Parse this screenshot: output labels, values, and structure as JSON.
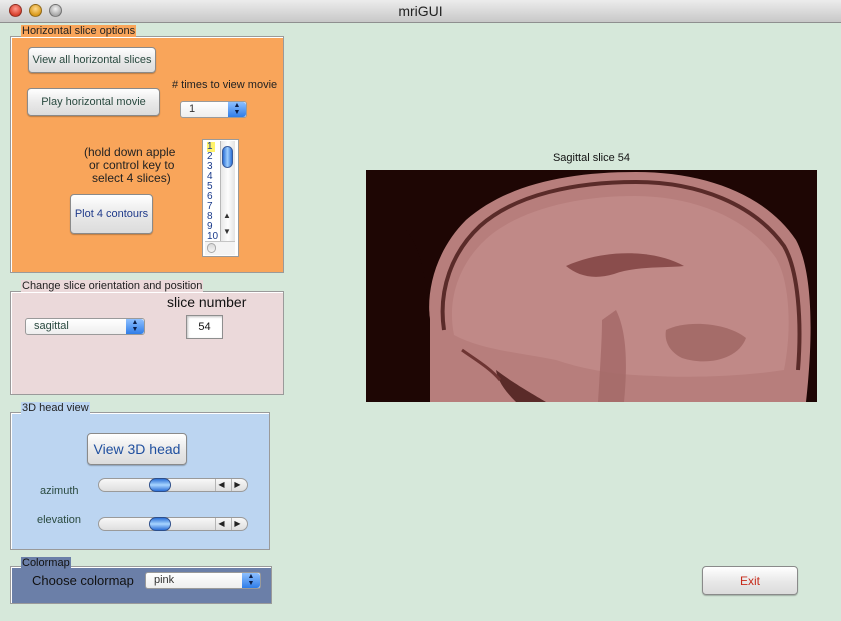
{
  "window": {
    "title": "mriGUI"
  },
  "horizontal": {
    "title": "Horizontal slice options",
    "view_all_label": "View all horizontal slices",
    "play_movie_label": "Play horizontal movie",
    "times_label": "# times to view movie",
    "times_value": "1",
    "hint_lines": [
      "(hold down apple",
      "or control key to",
      "select 4 slices)"
    ],
    "plot_contours_label": "Plot 4 contours",
    "slice_list": [
      "1",
      "2",
      "3",
      "4",
      "5",
      "6",
      "7",
      "8",
      "9",
      "10"
    ],
    "selected_slice": "1"
  },
  "orientation": {
    "title": "Change slice orientation and position",
    "slice_number_label": "slice number",
    "orientation_value": "sagittal",
    "slice_number_value": "54"
  },
  "head3d": {
    "title": "3D head view",
    "view_button_label": "View 3D head",
    "azimuth_label": "azimuth",
    "elevation_label": "elevation"
  },
  "colormap": {
    "title": "Colormap",
    "choose_label": "Choose colormap",
    "value": "pink"
  },
  "image": {
    "caption": "Sagittal slice 54"
  },
  "exit_label": "Exit",
  "colors": {
    "window_bg": "#d6e8da",
    "horizontal_bg": "#f9a55a",
    "orientation_bg": "#ebd9da",
    "head3d_bg": "#bcd5f1",
    "colormap_bg": "#6b7fa8",
    "mri_tissue": "#b77e7c",
    "mri_background": "#1e0604"
  },
  "icons": {
    "close": "close-icon",
    "minimize": "minimize-icon",
    "zoom": "zoom-icon",
    "popup_arrows": "up-down-arrows-icon",
    "slider_left": "left-arrow-icon",
    "slider_right": "right-arrow-icon"
  }
}
